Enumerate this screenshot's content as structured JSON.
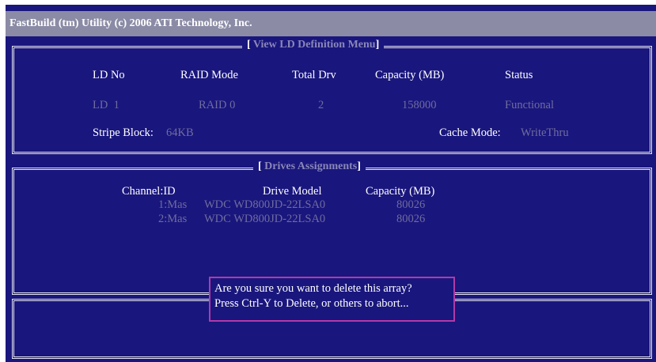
{
  "app": {
    "title": "FastBuild (tm) Utility (c) 2006 ATI Technology, Inc."
  },
  "ld_menu": {
    "title": "View LD Definition Menu",
    "headers": [
      "LD No",
      "RAID Mode",
      "Total Drv",
      "Capacity (MB)",
      "Status"
    ],
    "row": {
      "ld_no": "LD  1",
      "raid_mode": "RAID 0",
      "total_drv": "2",
      "capacity": "158000",
      "status": "Functional"
    },
    "stripe_label": "Stripe Block:",
    "stripe_value": "64KB",
    "cache_label": "Cache Mode:",
    "cache_value": "WriteThru"
  },
  "drives": {
    "title": "Drives Assignments",
    "headers": [
      "Channel:ID",
      "Drive Model",
      "Capacity (MB)"
    ],
    "rows": [
      {
        "channel": "1:Mas",
        "model": "WDC WD800JD-22LSA0",
        "capacity": "80026"
      },
      {
        "channel": "2:Mas",
        "model": "WDC WD800JD-22LSA0",
        "capacity": "80026"
      }
    ]
  },
  "dialog": {
    "line1": "Are you sure you want to delete this array?",
    "line2": "Press Ctrl-Y to Delete, or others to abort..."
  },
  "colors": {
    "background": "#19167d",
    "titlebar": "#8b8ba6",
    "text": "#ffffff",
    "dim_text": "#6f6d9e",
    "dialog_border": "#b13aa8"
  }
}
